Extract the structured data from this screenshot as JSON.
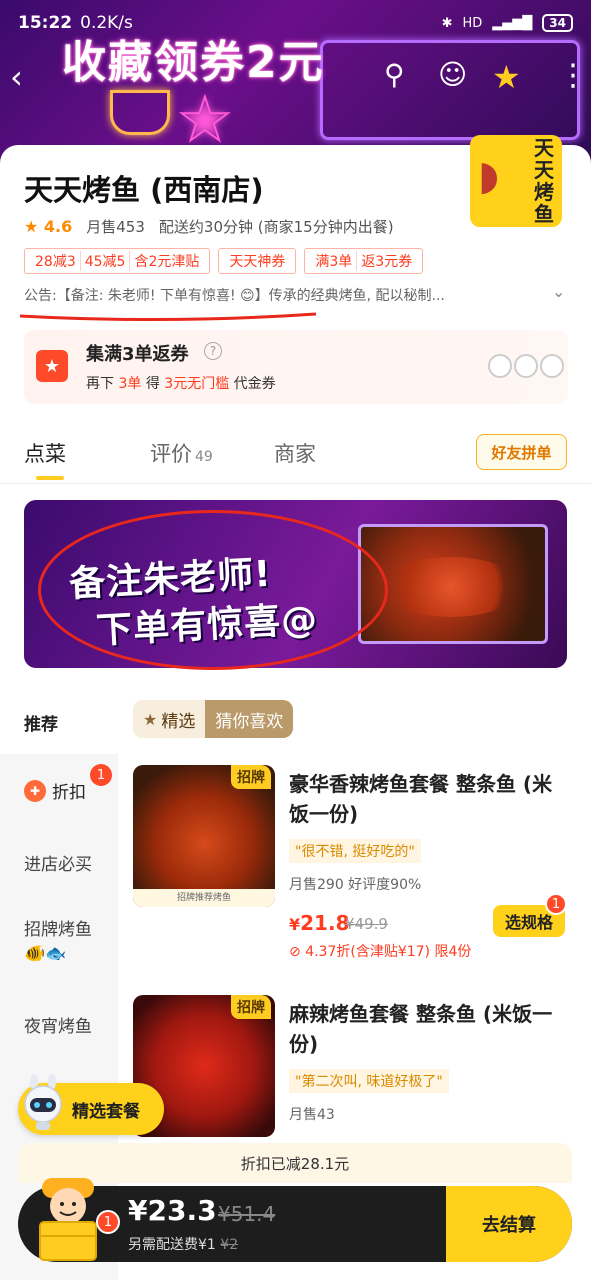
{
  "status_bar": {
    "time": "15:22",
    "network_speed": "0.2K/s",
    "battery": "34"
  },
  "banner": {
    "title": "收藏领券2元"
  },
  "store": {
    "name": "天天烤鱼 (西南店)",
    "logo_text": [
      "天",
      "天",
      "烤",
      "鱼"
    ],
    "rating": "4.6",
    "monthly_sales": "月售453",
    "delivery": "配送约30分钟 (商家15分钟内出餐)",
    "promos": [
      {
        "segments": [
          "28减3",
          "45减5",
          "含2元津贴"
        ]
      },
      {
        "segments": [
          "天天神券"
        ]
      },
      {
        "segments": [
          "满3单",
          "返3元券"
        ]
      }
    ],
    "notice": "公告:【备注: 朱老师! 下单有惊喜! 😊】传承的经典烤鱼, 配以秘制..."
  },
  "coupon": {
    "title": "集满3单返券",
    "sub_prefix": "再下",
    "sub_count": "3单",
    "sub_mid": "得",
    "sub_value": "3元无门槛",
    "sub_suffix": "代金券"
  },
  "tabs": {
    "items": [
      "点菜",
      "评价",
      "商家"
    ],
    "review_count": "49",
    "group_button": "好友拼单"
  },
  "promo_banner": {
    "line1": "备注朱老师!",
    "line2": "下单有惊喜@"
  },
  "menu": {
    "section_label": "推荐",
    "filter_on": "精选",
    "filter_off": "猜你喜欢",
    "sidebar": [
      "折扣",
      "进店必买",
      "招牌烤鱼",
      "夜宵烤鱼"
    ],
    "sidebar_badge": "1",
    "products": [
      {
        "tag": "招牌",
        "name": "豪华香辣烤鱼套餐  整条鱼 (米饭一份)",
        "quote": "\"很不错, 挺好吃的\"",
        "sales": "月售290  好评度90%",
        "price_currency": "¥",
        "price": "21.8",
        "original_price": "¥49.9",
        "discount": "4.37折(含津贴¥17) 限4份",
        "button": "选规格",
        "badge": "1",
        "image_caption": "招牌推荐烤鱼"
      },
      {
        "tag": "招牌",
        "name": "麻辣烤鱼套餐  整条鱼 (米饭一份)",
        "quote": "\"第二次叫, 味道好极了\"",
        "sales": "月售43"
      }
    ]
  },
  "set_chip": {
    "label": "精选套餐"
  },
  "cart": {
    "discount_note": "折扣已减28.1元",
    "price": "¥23.3",
    "original_price": "¥51.4",
    "fee_text": "另需配送费¥1",
    "fee_original": "¥2",
    "badge": "1",
    "checkout": "去结算"
  }
}
